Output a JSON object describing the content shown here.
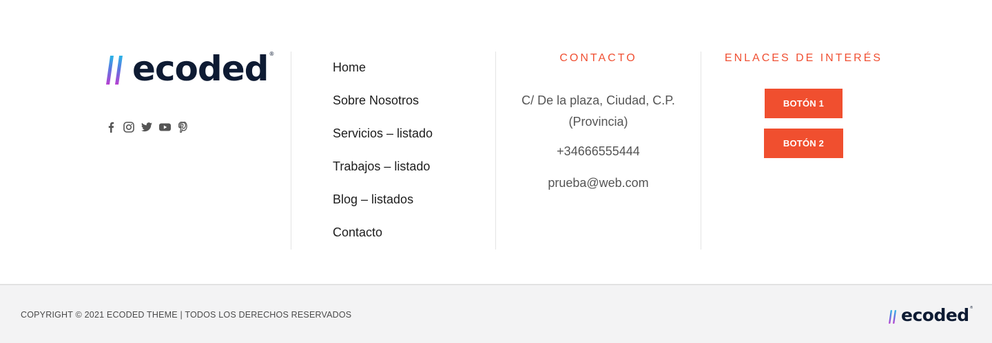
{
  "brand": {
    "name": "ecoded",
    "reg": "®"
  },
  "social": [
    {
      "icon": "facebook-icon"
    },
    {
      "icon": "instagram-icon"
    },
    {
      "icon": "twitter-icon"
    },
    {
      "icon": "youtube-icon"
    },
    {
      "icon": "pinterest-icon"
    }
  ],
  "menu": {
    "items": [
      {
        "label": "Home"
      },
      {
        "label": "Sobre Nosotros"
      },
      {
        "label": "Servicios – listado"
      },
      {
        "label": "Trabajos – listado"
      },
      {
        "label": "Blog – listados"
      },
      {
        "label": "Contacto"
      }
    ]
  },
  "contact": {
    "title": "CONTACTO",
    "address_line1": "C/ De la plaza, Ciudad, C.P.",
    "address_line2": "(Provincia)",
    "phone": "+34666555444",
    "email": "prueba@web.com"
  },
  "links": {
    "title": "ENLACES DE INTERÉS",
    "button1": "BOTÓN 1",
    "button2": "BOTÓN 2"
  },
  "bottom": {
    "copyright": "COPYRIGHT © 2021 ECODED THEME | TODOS LOS DERECHOS RESERVADOS"
  },
  "colors": {
    "accent": "#f04f2f",
    "brand_dark": "#0e1b33",
    "footer_bg": "#f3f3f4"
  }
}
